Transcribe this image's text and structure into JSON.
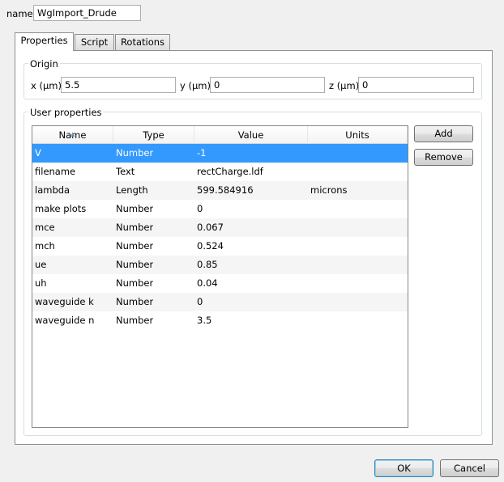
{
  "name_field": {
    "label": "name",
    "value": "WgImport_Drude"
  },
  "tabs": [
    {
      "label": "Properties",
      "active": true
    },
    {
      "label": "Script",
      "active": false
    },
    {
      "label": "Rotations",
      "active": false
    }
  ],
  "origin": {
    "title": "Origin",
    "x": {
      "label": "x (μm)",
      "value": "5.5"
    },
    "y": {
      "label": "y (μm)",
      "value": "0"
    },
    "z": {
      "label": "z (μm)",
      "value": "0"
    }
  },
  "user_properties": {
    "title": "User properties",
    "columns": [
      "Name",
      "Type",
      "Value",
      "Units"
    ],
    "rows": [
      {
        "name": "V",
        "type": "Number",
        "value": "-1",
        "units": ""
      },
      {
        "name": "filename",
        "type": "Text",
        "value": "rectCharge.ldf",
        "units": ""
      },
      {
        "name": "lambda",
        "type": "Length",
        "value": "599.584916",
        "units": "microns"
      },
      {
        "name": "make plots",
        "type": "Number",
        "value": "0",
        "units": ""
      },
      {
        "name": "mce",
        "type": "Number",
        "value": "0.067",
        "units": ""
      },
      {
        "name": "mch",
        "type": "Number",
        "value": "0.524",
        "units": ""
      },
      {
        "name": "ue",
        "type": "Number",
        "value": "0.85",
        "units": ""
      },
      {
        "name": "uh",
        "type": "Number",
        "value": "0.04",
        "units": ""
      },
      {
        "name": "waveguide k",
        "type": "Number",
        "value": "0",
        "units": ""
      },
      {
        "name": "waveguide n",
        "type": "Number",
        "value": "3.5",
        "units": ""
      }
    ],
    "selected_row": 0,
    "add_label": "Add",
    "remove_label": "Remove"
  },
  "footer": {
    "ok_label": "OK",
    "cancel_label": "Cancel"
  },
  "colors": {
    "selection": "#3399ff",
    "window_bg": "#f0f0f0"
  }
}
